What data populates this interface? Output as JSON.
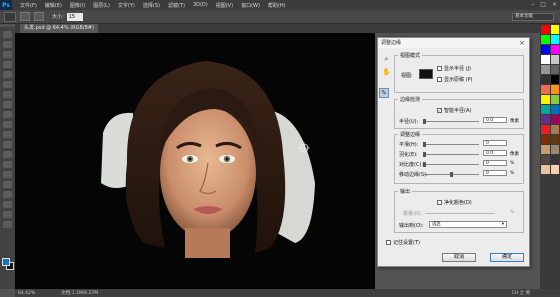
{
  "app": {
    "logo": "Ps"
  },
  "menu": [
    "文件(F)",
    "编辑(E)",
    "图像(I)",
    "图层(L)",
    "文字(Y)",
    "选择(S)",
    "滤镜(T)",
    "3D(D)",
    "视图(V)",
    "窗口(W)",
    "帮助(H)"
  ],
  "options": {
    "size_label": "大小:",
    "size_value": "15",
    "workspace": "基本功能"
  },
  "document": {
    "tab_title": "头发.psd @ 64.4% (RGB/8#)"
  },
  "status": {
    "zoom": "64.42%",
    "doc": "文档:1.1M/6.27M",
    "right": "CH 之 简"
  },
  "dialog": {
    "title": "调整边缘",
    "view_mode": {
      "title": "视图模式",
      "view_label": "视图:",
      "show_radius": "显示半径 (J)",
      "show_original": "显示原稿 (P)"
    },
    "edge_detect": {
      "title": "边缘检测",
      "smart_radius": "智能半径(A)",
      "radius_label": "半径(U):",
      "radius_value": "0.0",
      "radius_unit": "像素"
    },
    "adjust_edge": {
      "title": "调整边缘",
      "rows": [
        {
          "label": "平滑(H):",
          "value": "0",
          "unit": ""
        },
        {
          "label": "羽化(E):",
          "value": "0.0",
          "unit": "像素"
        },
        {
          "label": "对比度(C):",
          "value": "0",
          "unit": "%"
        },
        {
          "label": "移动边缘(S):",
          "value": "0",
          "unit": "%"
        }
      ]
    },
    "output": {
      "title": "输出",
      "decontaminate": "净化颜色(D)",
      "amount_label": "数量(N):",
      "amount_unit": "%",
      "output_to_label": "输出到(O):",
      "output_to_value": "选区"
    },
    "remember": "记住设置(T)",
    "cancel": "取消",
    "ok": "确定"
  },
  "colors": {
    "accent": "#1570c8",
    "swatches": [
      "#ff0000",
      "#ffff00",
      "#00ff00",
      "#00ffff",
      "#0000ff",
      "#ff00ff",
      "#ffffff",
      "#c8c8c8",
      "#969696",
      "#646464",
      "#323232",
      "#000000",
      "#f26c4f",
      "#f7941d",
      "#fff200",
      "#8dc63f",
      "#00a99d",
      "#0072bc",
      "#662d91",
      "#9e005d",
      "#ed1c24",
      "#a67c52",
      "#7b2e00",
      "#603913",
      "#c69c6d",
      "#998675",
      "#534741",
      "#363636",
      "#e8c4a0",
      "#f5d0b0"
    ]
  }
}
